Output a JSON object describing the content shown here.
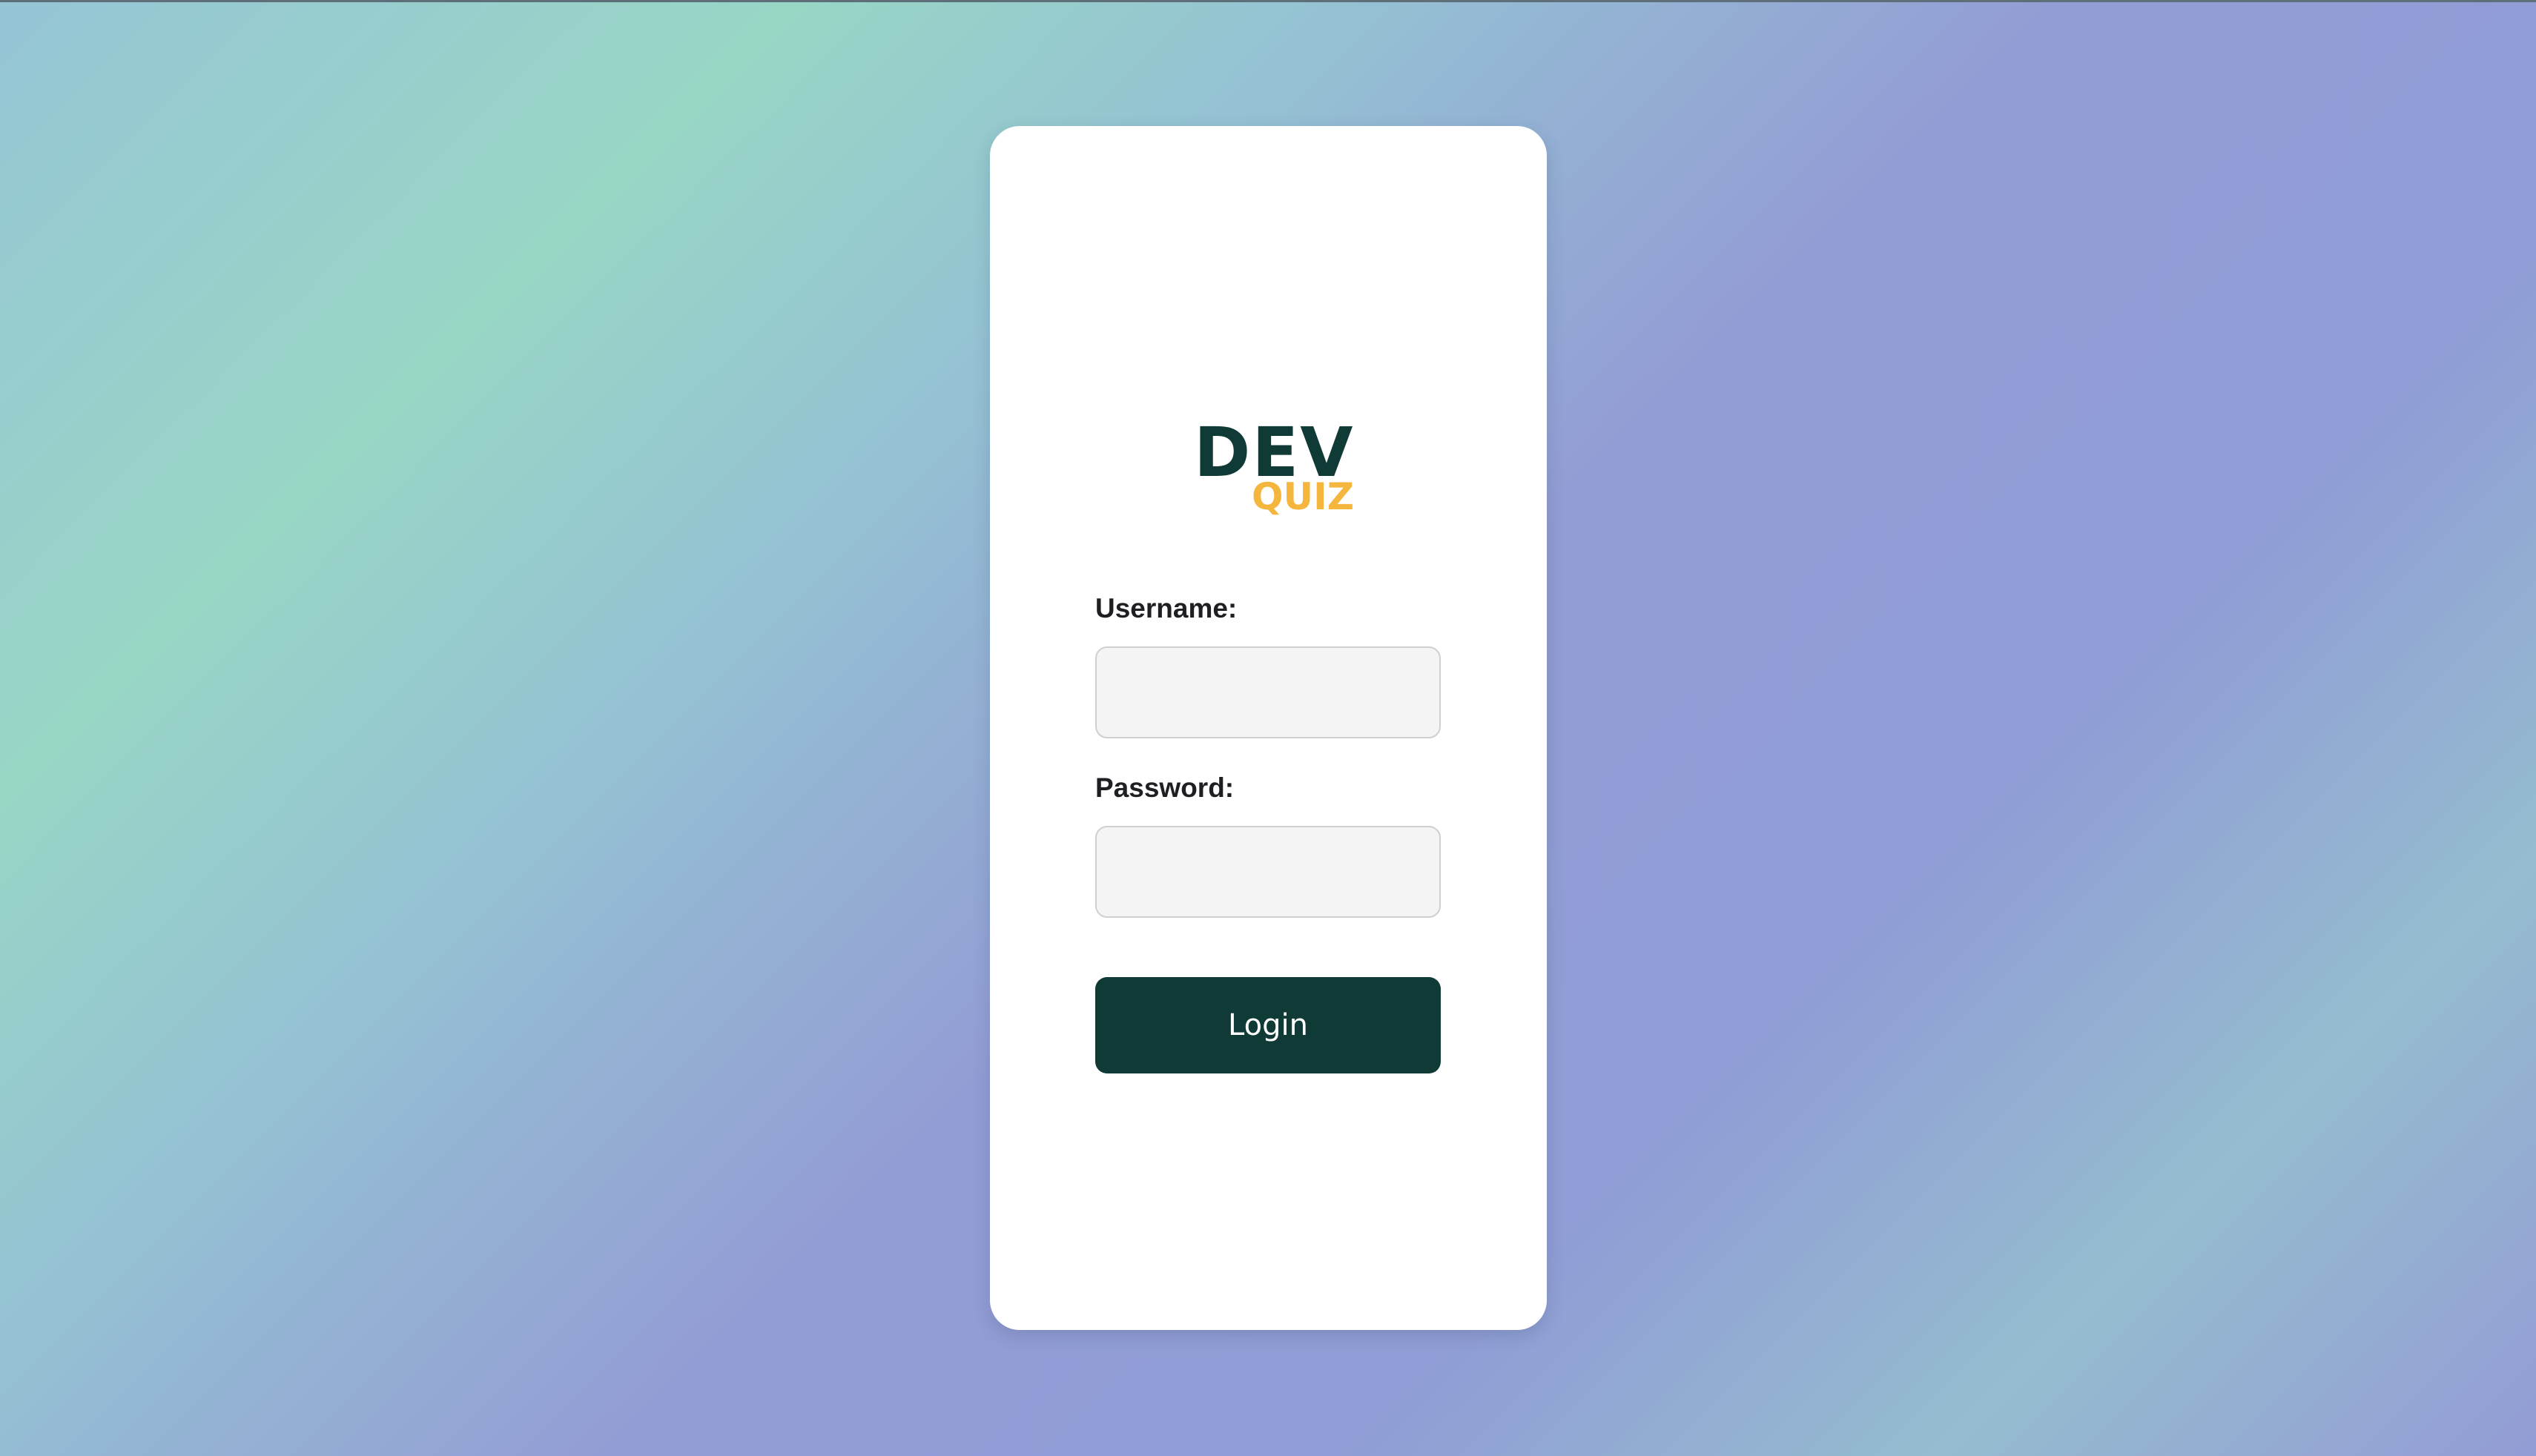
{
  "logo": {
    "primary": "DEV",
    "secondary": "QUIZ"
  },
  "form": {
    "username_label": "Username:",
    "username_value": "",
    "password_label": "Password:",
    "password_value": "",
    "submit_label": "Login"
  },
  "colors": {
    "brand_dark": "#0f3a35",
    "brand_accent": "#f4b63c",
    "card_background": "#ffffff",
    "input_background": "#f4f4f4"
  }
}
